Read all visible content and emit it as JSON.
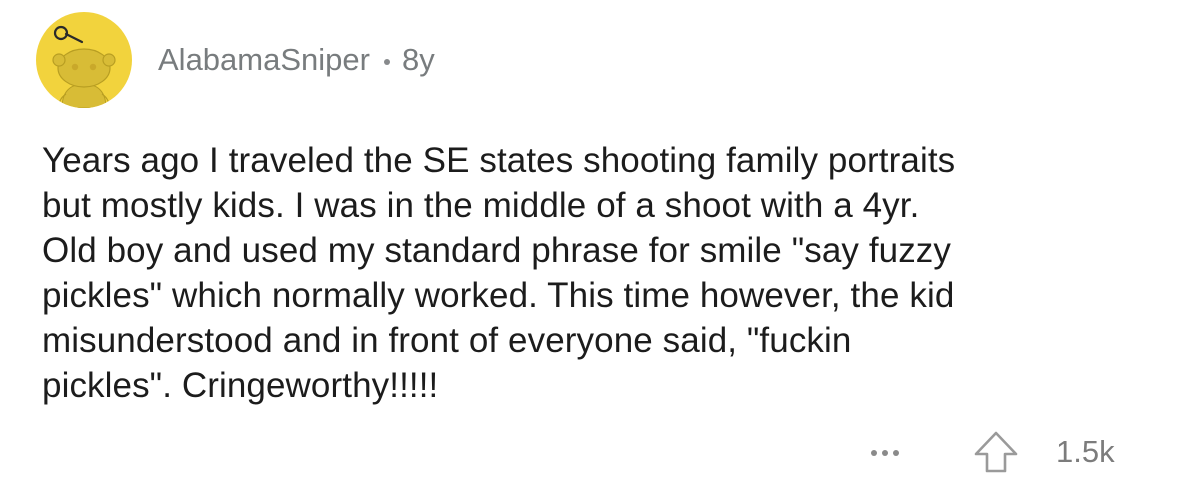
{
  "comment": {
    "author": "AlabamaSniper",
    "age": "8y",
    "body_lines": [
      "Years ago I traveled the SE states shooting family portraits",
      "but mostly kids. I was in the middle of a shoot with a 4yr.",
      "Old boy and used my standard phrase for smile \"say fuzzy",
      "pickles\" which normally worked. This time however, the kid",
      "misunderstood and in front of everyone said, \"fuckin",
      "pickles\". Cringeworthy!!!!!"
    ],
    "score": "1.5k"
  },
  "icons": {
    "avatar": "snoo-avatar-icon",
    "more": "more-options-icon",
    "upvote": "upvote-arrow-icon"
  },
  "colors": {
    "avatar_bg": "#f2d33d",
    "meta_text": "#787c7e",
    "body_text": "#1c1c1c"
  }
}
